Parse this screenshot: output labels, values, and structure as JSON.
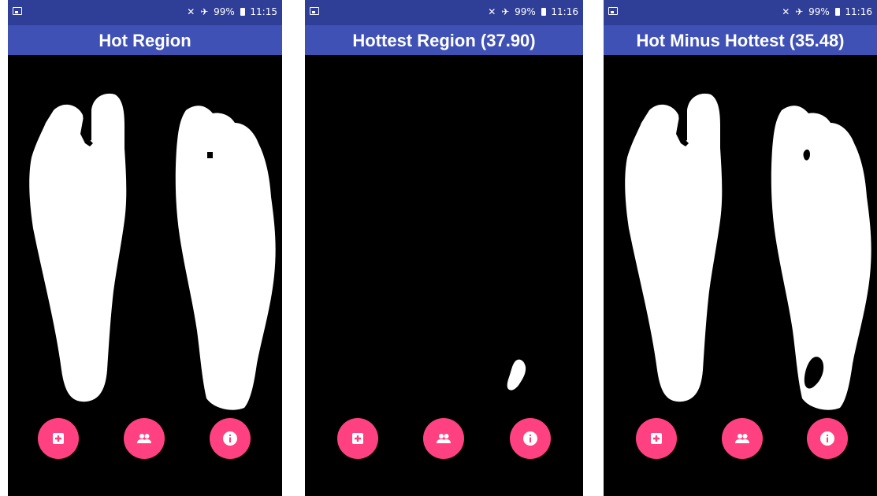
{
  "status_bar": {
    "notification_icon": "image-notification-icon",
    "mute_icon": "mute-icon",
    "airplane_icon": "airplane-icon",
    "battery": "99%",
    "battery_icon": "battery-icon"
  },
  "screens": [
    {
      "title": "Hot Region",
      "time": "11:15"
    },
    {
      "title": "Hottest Region (37.90)",
      "time": "11:16"
    },
    {
      "title": "Hot Minus Hottest (35.48)",
      "time": "11:16"
    }
  ],
  "fab_icons": [
    "add-box-icon",
    "people-icon",
    "info-icon"
  ],
  "colors": {
    "status_bar": "#2f3e97",
    "app_bar": "#3f51b5",
    "fab": "#ff4081",
    "canvas": "#000000",
    "region": "#ffffff"
  }
}
